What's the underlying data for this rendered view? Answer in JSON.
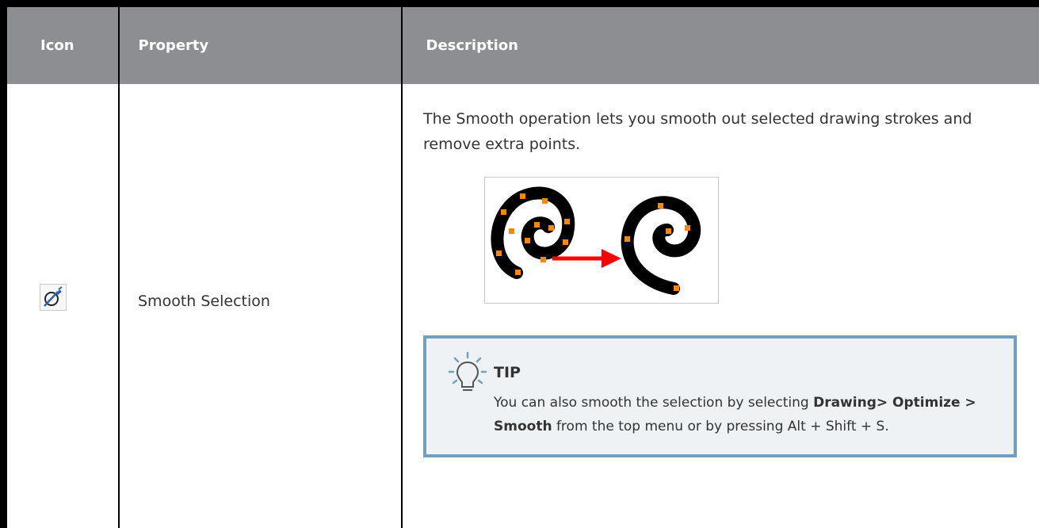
{
  "table": {
    "headers": {
      "icon": "Icon",
      "property": "Property",
      "description": "Description"
    }
  },
  "row": {
    "icon_name": "smooth-selection-icon",
    "property": "Smooth Selection",
    "description": "The Smooth operation lets you smooth out selected drawing strokes and remove extra points."
  },
  "tip": {
    "title": "TIP",
    "text_1": "You can also smooth the selection by selecting ",
    "bold_1": "Drawing> Optimize > Smooth",
    "text_2": " from the top menu or by pressing Alt + Shift + S."
  },
  "colors": {
    "header_bg": "#8d8e91",
    "tip_border": "#6f9fc1",
    "tip_bg": "#eef2f5",
    "point_orange": "#ff8800",
    "arrow_red": "#ff0000"
  }
}
